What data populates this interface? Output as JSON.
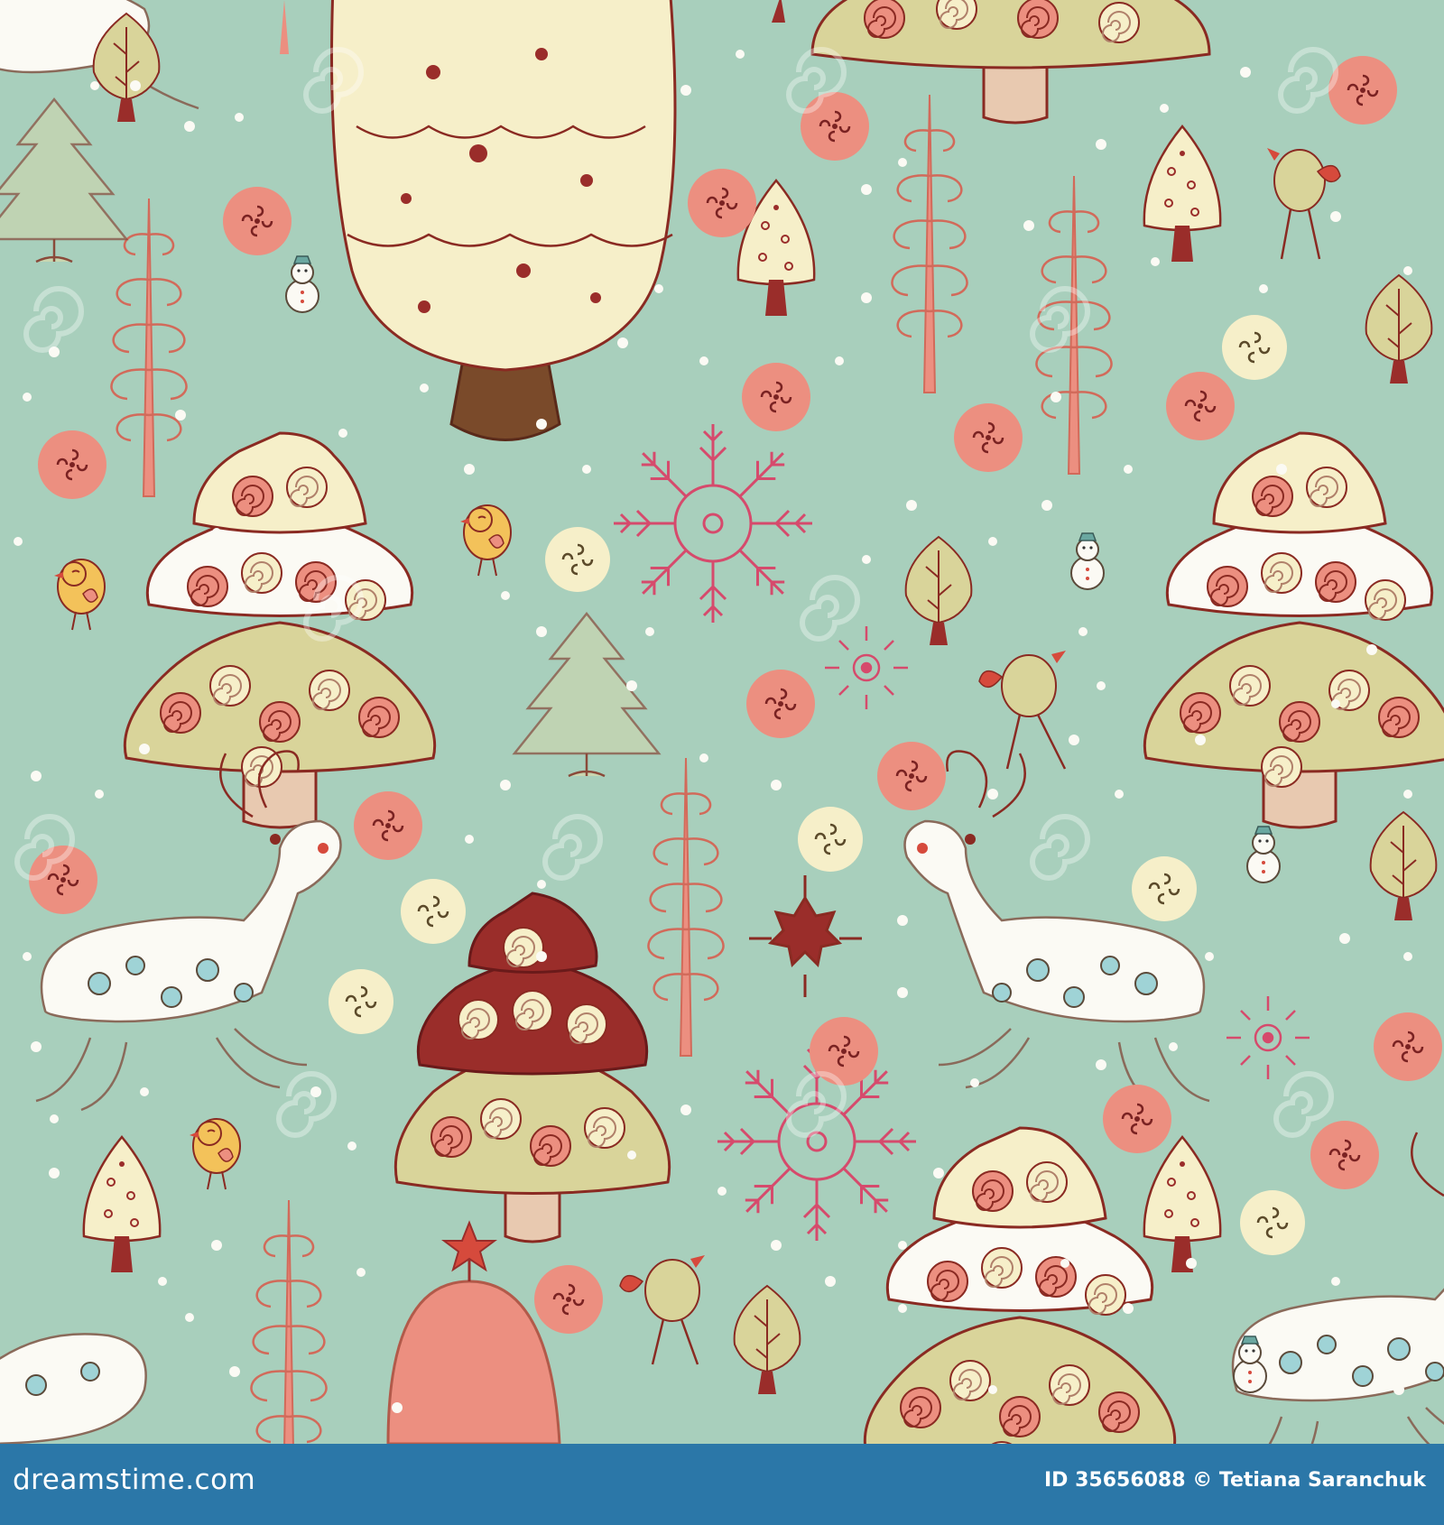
{
  "footer": {
    "site_name": "dreamstime.com",
    "image_id_text": "ID 35656088 © Tetiana Saranchuk"
  },
  "palette": {
    "background": "#a8cfbc",
    "footer_bar": "#2b77a8",
    "outline": "#8a2a22",
    "cream": "#f6efc9",
    "olive": "#d9d49a",
    "coral": "#ec8f80",
    "dark_red": "#9a2d2a",
    "white": "#fbfaf4",
    "yellow_bird": "#f3c25a",
    "pink_snowflake": "#d64a6c"
  },
  "motifs": {
    "big_tree_icon": "layered-christmas-tree",
    "round_ornament_icon": "coral-ornament-circle",
    "curly_tree_icon": "curly-tree",
    "reindeer_icon": "white-reindeer",
    "bird_icon": "bird",
    "snowman_icon": "snowman",
    "snowflake_icon": "snowflake",
    "leaf_tree_icon": "leaf-tree",
    "small_tree_icon": "triangle-tree",
    "watermark_icon": "spiral-watermark"
  }
}
